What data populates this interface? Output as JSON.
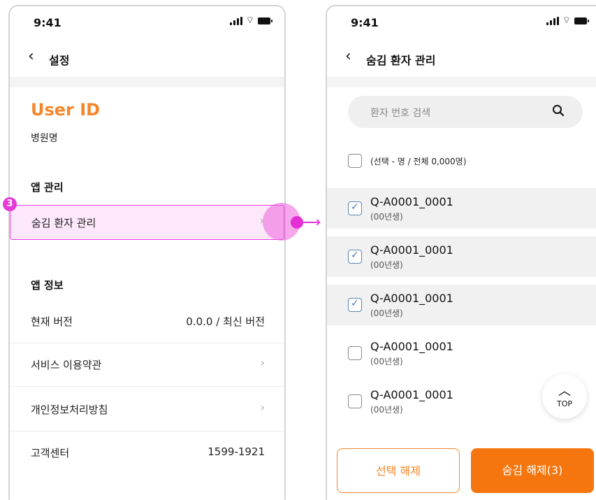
{
  "status_time": "9:41",
  "settings": {
    "title": "설정",
    "user_id": "User ID",
    "hospital": "병원명",
    "app_manage_title": "앱 관리",
    "hidden_patients_label": "숨김 환자 관리",
    "app_info_title": "앱 정보",
    "version_label": "현재 버전",
    "version_value": "0.0.0 / 최신 버전",
    "terms_label": "서비스 이용약관",
    "privacy_label": "개인정보처리방침",
    "support_label": "고객센터",
    "support_value": "1599-1921"
  },
  "annotation": {
    "badge": "3"
  },
  "hidden": {
    "title": "숨김 환자 관리",
    "search_placeholder": "환자 번호 검색",
    "select_info": "(선택 - 명 / 전체 0,000명)",
    "patients": [
      {
        "id": "Q-A0001_0001",
        "birth": "(00년생)",
        "checked": true
      },
      {
        "id": "Q-A0001_0001",
        "birth": "(00년생)",
        "checked": true
      },
      {
        "id": "Q-A0001_0001",
        "birth": "(00년생)",
        "checked": true
      },
      {
        "id": "Q-A0001_0001",
        "birth": "(00년생)",
        "checked": false
      },
      {
        "id": "Q-A0001_0001",
        "birth": "(00년생)",
        "checked": false
      }
    ],
    "top_label": "TOP",
    "deselect_button": "선택 해제",
    "unhide_button": "숨김 해제(3)"
  },
  "colors": {
    "accent": "#f5862a",
    "annotation": "#e52fd6"
  }
}
